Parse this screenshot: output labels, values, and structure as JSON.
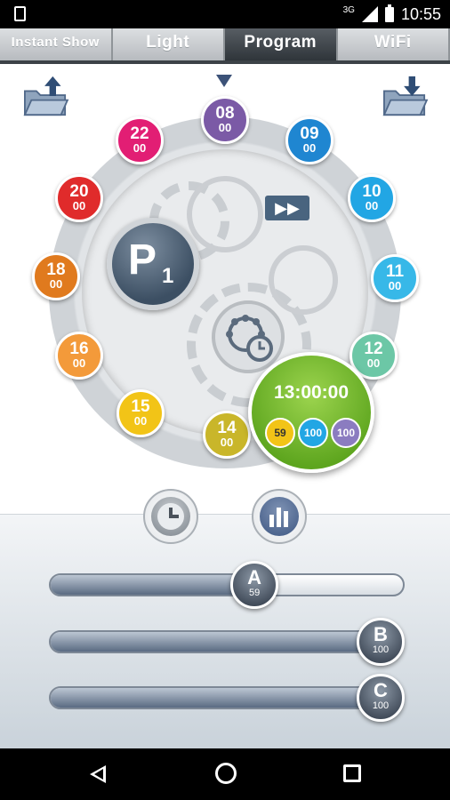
{
  "status_bar": {
    "network": "3G",
    "time": "10:55"
  },
  "tabs": [
    {
      "label": "Instant Show"
    },
    {
      "label": "Light"
    },
    {
      "label": "Program",
      "active": true
    },
    {
      "label": "WiFi"
    }
  ],
  "program": {
    "letter": "P",
    "number": "1"
  },
  "schedule": [
    {
      "hour": "08",
      "minute": "00",
      "color": "#7b5aa6"
    },
    {
      "hour": "09",
      "minute": "00",
      "color": "#1f86d1"
    },
    {
      "hour": "10",
      "minute": "00",
      "color": "#22a6e4"
    },
    {
      "hour": "11",
      "minute": "00",
      "color": "#37b8e8"
    },
    {
      "hour": "12",
      "minute": "00",
      "color": "#6cc7a6"
    },
    {
      "hour": "14",
      "minute": "00",
      "color": "#c9b62a"
    },
    {
      "hour": "15",
      "minute": "00",
      "color": "#f2c417"
    },
    {
      "hour": "16",
      "minute": "00",
      "color": "#f39a3a"
    },
    {
      "hour": "18",
      "minute": "00",
      "color": "#e07a1e"
    },
    {
      "hour": "20",
      "minute": "00",
      "color": "#e02b2b"
    },
    {
      "hour": "22",
      "minute": "00",
      "color": "#e21e74"
    }
  ],
  "current": {
    "time": "13:00:00",
    "chips": [
      {
        "value": "59",
        "color": "#f2c417",
        "text_color": "#333333"
      },
      {
        "value": "100",
        "color": "#22a6e4",
        "text_color": "#ffffff"
      },
      {
        "value": "100",
        "color": "#8b7cc0",
        "text_color": "#ffffff"
      }
    ]
  },
  "sliders": [
    {
      "label": "A",
      "value": "59",
      "fraction": 0.59
    },
    {
      "label": "B",
      "value": "100",
      "fraction": 1.0
    },
    {
      "label": "C",
      "value": "100",
      "fraction": 1.0
    }
  ],
  "colors": {
    "accent_green": "#6bb82a",
    "tab_active": "#3f454b"
  }
}
